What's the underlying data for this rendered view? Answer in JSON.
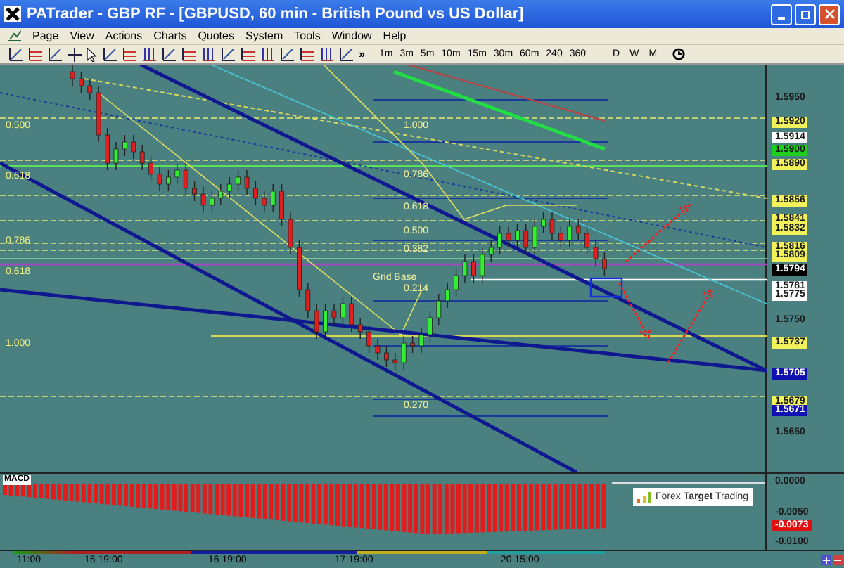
{
  "window": {
    "title": "PATrader - GBP RF - [GBPUSD, 60 min - British Pound vs US Dollar]"
  },
  "menu": [
    "Page",
    "View",
    "Actions",
    "Charts",
    "Quotes",
    "System",
    "Tools",
    "Window",
    "Help"
  ],
  "toolbar": {
    "more": "»",
    "timeframes": [
      "1m",
      "3m",
      "5m",
      "10m",
      "15m",
      "30m",
      "60m",
      "240",
      "360"
    ],
    "periods": [
      "D",
      "W",
      "M"
    ]
  },
  "chart": {
    "left_labels": [
      "0.500",
      "0.618",
      "0.786",
      "0.618",
      "1.000"
    ],
    "grid_labels": [
      "1.000",
      "0.786",
      "0.618",
      "0.500",
      "0.382",
      "Grid Base",
      "0.214",
      "0.270"
    ],
    "price_axis": [
      {
        "text": "1.5950",
        "kind": "tick"
      },
      {
        "text": "1.5920",
        "kind": "marker",
        "color": "#f2f25a"
      },
      {
        "text": "1.5914",
        "kind": "marker",
        "color": "#ffffff"
      },
      {
        "text": "1.5900",
        "kind": "marker",
        "color": "#1fd11f"
      },
      {
        "text": "1.5890",
        "kind": "marker",
        "color": "#f2f25a"
      },
      {
        "text": "1.5856",
        "kind": "marker",
        "color": "#f2f25a"
      },
      {
        "text": "1.5841",
        "kind": "marker",
        "color": "#f2f25a"
      },
      {
        "text": "1.5832",
        "kind": "marker",
        "color": "#f2f25a"
      },
      {
        "text": "1.5816",
        "kind": "marker",
        "color": "#f2f25a"
      },
      {
        "text": "1.5809",
        "kind": "marker",
        "color": "#f2f25a"
      },
      {
        "text": "1.5794",
        "kind": "marker",
        "color": "#000000"
      },
      {
        "text": "1.5781",
        "kind": "marker",
        "color": "#ffffff"
      },
      {
        "text": "1.5775",
        "kind": "marker",
        "color": "#ffffff"
      },
      {
        "text": "1.5750",
        "kind": "tick"
      },
      {
        "text": "1.5737",
        "kind": "marker",
        "color": "#f2f25a"
      },
      {
        "text": "1.5705",
        "kind": "marker",
        "color": "#1010b0"
      },
      {
        "text": "1.5679",
        "kind": "marker",
        "color": "#f2f25a"
      },
      {
        "text": "1.5671",
        "kind": "marker",
        "color": "#1010b0"
      },
      {
        "text": "1.5650",
        "kind": "tick"
      }
    ]
  },
  "macd": {
    "label": "MACD",
    "logo": "Forex **Target** Trading",
    "axis": [
      {
        "text": "0.0000",
        "kind": "tick"
      },
      {
        "text": "-0.0050",
        "kind": "tick"
      },
      {
        "text": "-0.0073",
        "kind": "marker",
        "color": "#e01010"
      },
      {
        "text": "-0.0100",
        "kind": "tick"
      }
    ]
  },
  "time_axis": [
    "11:00",
    "15 19:00",
    "16 19:00",
    "17 19:00",
    "20 15:00"
  ]
}
